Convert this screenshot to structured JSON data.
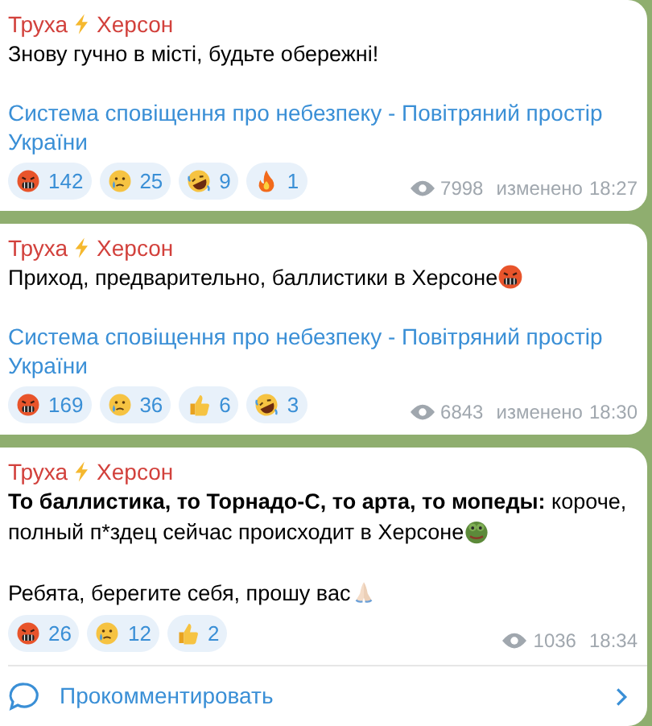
{
  "messages": [
    {
      "author": "Труха",
      "author_icon": {
        "kind": "bolt"
      },
      "author_place": "Херсон",
      "paragraphs": [
        {
          "text": "Знову гучно в місті, будьте обережні!"
        }
      ],
      "link": "Система сповіщення про небезпеку - Повітряний простір України",
      "reactions": [
        {
          "kind": "angry",
          "count": "142"
        },
        {
          "kind": "cry",
          "count": "25"
        },
        {
          "kind": "rofl",
          "count": "9"
        },
        {
          "kind": "fire",
          "count": "1"
        }
      ],
      "views": "7998",
      "edited": "изменено",
      "time": "18:27"
    },
    {
      "author": "Труха",
      "author_icon": {
        "kind": "bolt"
      },
      "author_place": "Херсон",
      "paragraphs": [
        {
          "text": "Приход, предварительно, баллистики в Херсоне",
          "trailing_icon": {
            "kind": "angry"
          }
        }
      ],
      "link": "Система сповіщення про небезпеку - Повітряний простір України",
      "reactions": [
        {
          "kind": "angry",
          "count": "169"
        },
        {
          "kind": "cry",
          "count": "36"
        },
        {
          "kind": "thumbs",
          "count": "6"
        },
        {
          "kind": "rofl",
          "count": "3"
        }
      ],
      "views": "6843",
      "edited": "изменено",
      "time": "18:30"
    },
    {
      "author": "Труха",
      "author_icon": {
        "kind": "bolt"
      },
      "author_place": "Херсон",
      "paragraphs": [
        {
          "lines": [
            {
              "lead": "То баллистика, то Торнадо-С, то арта, то мопеды:",
              "text": " короче,"
            },
            {
              "text": "полный п*здец сейчас происходит в Херсоне"
            }
          ],
          "trailing_icon": {
            "kind": "frog"
          }
        },
        {
          "text": "Ребята, берегите себя, прошу вас",
          "trailing_icon": {
            "kind": "pray"
          }
        }
      ],
      "reactions": [
        {
          "kind": "angry",
          "count": "26"
        },
        {
          "kind": "cry",
          "count": "12"
        },
        {
          "kind": "thumbs",
          "count": "2"
        }
      ],
      "views": "1036",
      "time": "18:34",
      "comment_label": "Прокомментировать"
    }
  ]
}
